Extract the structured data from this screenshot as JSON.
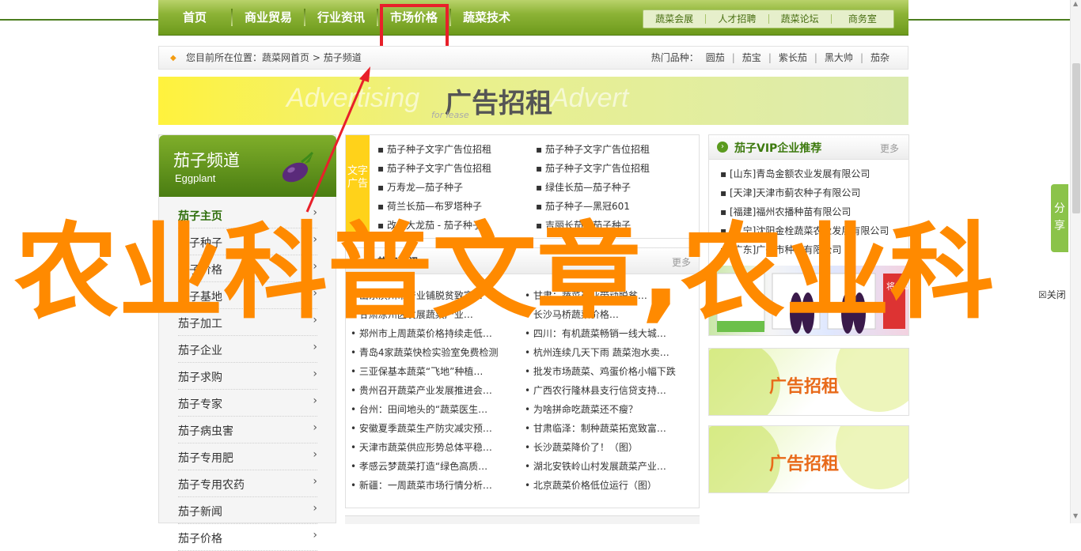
{
  "nav": {
    "main": [
      "首页",
      "商业贸易",
      "行业资讯",
      "市场价格",
      "蔬菜技术"
    ],
    "sub": [
      "蔬菜会展",
      "人才招聘",
      "蔬菜论坛",
      "商务室"
    ]
  },
  "breadcrumb": {
    "prefix": "您目前所在位置：",
    "home": "蔬菜网首页",
    "sep": " > ",
    "current": "茄子频道",
    "hot_label": "热门品种：",
    "hot_items": [
      "圆茄",
      "茄宝",
      "紫长茄",
      "黑大帅",
      "茄杂"
    ]
  },
  "banner": {
    "ghost_left": "Advertising",
    "ghost_right": "Advert",
    "main": "广告招租",
    "small": "for lease"
  },
  "sidebar": {
    "title": "茄子频道",
    "subtitle": "Eggplant",
    "items": [
      "茄子主页",
      "茄子种子",
      "茄子价格",
      "茄子基地",
      "茄子加工",
      "茄子企业",
      "茄子求购",
      "茄子专家",
      "茄子病虫害",
      "茄子专用肥",
      "茄子专用农药",
      "茄子新闻",
      "茄子价格"
    ]
  },
  "ad_text": {
    "tag": "文字广告",
    "rows": [
      [
        "茄子种子文字广告位招租",
        "茄子种子文字广告位招租"
      ],
      [
        "茄子种子文字广告位招租",
        "茄子种子文字广告位招租"
      ],
      [
        "万寿龙—茄子种子",
        "绿佳长茄—茄子种子"
      ],
      [
        "荷兰长茄—布罗塔种子",
        "茄子种子—黑冠601"
      ],
      [
        "改良大龙茄 - 茄子种子",
        "吉丽长茄—茄子种子"
      ]
    ]
  },
  "news": {
    "title": "热点资讯",
    "more": "更多",
    "rows": [
      [
        "山东滨州市产业铺脱贫致富…",
        "甘肃：蔬菜产业带动脱贫…"
      ],
      [
        "甘肃凉州区发展蔬菜产业…",
        "长沙马桥蔬菜价格…"
      ],
      [
        "郑州市上周蔬菜价格持续走低…",
        "四川：有机蔬菜畅销一线大城…"
      ],
      [
        "青岛4家蔬菜快检实验室免费检测",
        "杭州连续几天下雨 蔬菜泡水卖…"
      ],
      [
        "三亚保基本蔬菜“飞地”种植…",
        "批发市场蔬菜、鸡蛋价格小幅下跌"
      ],
      [
        "贵州召开蔬菜产业发展推进会…",
        "广西农行隆林县支行信贷支持…"
      ],
      [
        "台州：田间地头的“蔬菜医生…",
        "为啥拼命吃蔬菜还不瘦？"
      ],
      [
        "安徽夏季蔬菜生产防灾减灾预…",
        "甘肃临泽：制种蔬菜拓宽致富…"
      ],
      [
        "天津市蔬菜供应形势总体平稳…",
        "长沙蔬菜降价了！（图）"
      ],
      [
        "孝感云梦蔬菜打造“绿色高质…",
        "湖北安铁岭山村发展蔬菜产业…"
      ],
      [
        "新疆：一周蔬菜市场行情分析…",
        "北京蔬菜价格低位运行（图）"
      ]
    ]
  },
  "vip": {
    "title": "茄子VIP企业推荐",
    "more": "更多",
    "rows": [
      "[山东]青岛金额农业发展有限公司",
      "[天津]天津市蓟农种子有限公司",
      "[福建]福州农播种苗有限公司",
      "[辽宁]沈阳金栓蔬菜农业发展有限公司",
      "[广东]广州市种苗有限公司"
    ],
    "product_label": "将来88"
  },
  "ad_tiles": [
    "广告招租",
    "广告招租"
  ],
  "share": "分享",
  "close": "关闭",
  "overlay_text": "农业科普文章,农业科",
  "colors": {
    "nav_green": "#6d9a1c",
    "accent_orange": "#ff8a00",
    "highlight_red": "#e8202a"
  }
}
